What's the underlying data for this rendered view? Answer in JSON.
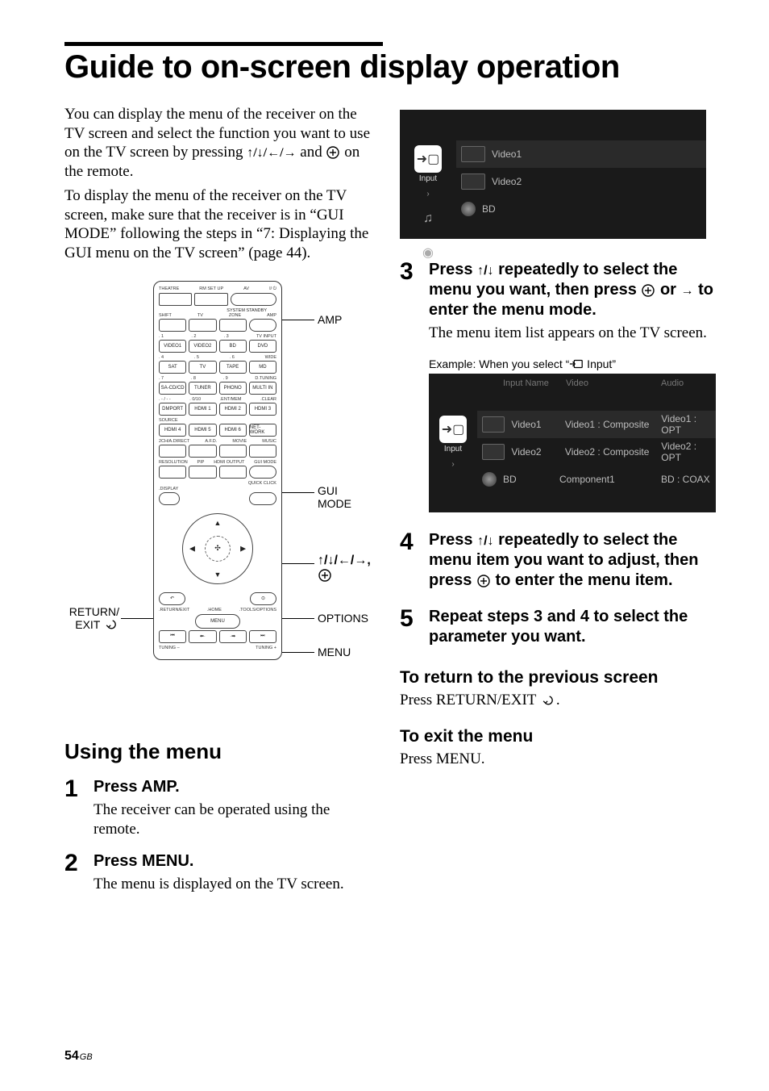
{
  "title": "Guide to on-screen display operation",
  "intro1": "You can display the menu of the receiver on the TV screen and select the function you want to use on the TV screen by pressing ",
  "arrows_inline": "↑/↓/←/→",
  "intro1b": " and ",
  "intro1c": " on the remote.",
  "intro2": "To display the menu of the receiver on the TV screen, make sure that the receiver is in “GUI MODE” following the steps in “7: Displaying the GUI menu on the TV screen” (page 44).",
  "callouts": {
    "amp": "AMP",
    "gui": "GUI\nMODE",
    "dir": "↑/↓/←/→,",
    "options": "OPTIONS",
    "menu": "MENU",
    "return": "RETURN/\nEXIT "
  },
  "remote_labels": {
    "top_row": [
      "THEATRE",
      "RM SET UP",
      "AV",
      " "
    ],
    "top_small": "SYSTEM STANDBY",
    "mode_row": [
      "SHIFT",
      "TV",
      "ZONE",
      "AMP"
    ],
    "grid": [
      [
        ". 1",
        ". 2",
        ". 3",
        "TV INPUT"
      ],
      [
        "VIDEO1",
        "VIDEO2",
        "BD",
        "DVD"
      ],
      [
        ". 4",
        ". 5",
        ". 6",
        "WIDE"
      ],
      [
        "SAT",
        "TV",
        "TAPE",
        "MD"
      ],
      [
        ". 7",
        ". 8",
        ". 9",
        "D.TUNING"
      ],
      [
        "SA-CD/CD",
        "TUNER",
        "PHONO",
        "MULTI IN"
      ],
      [
        ". - / - -",
        ". 0/10",
        ".ENT/MEM",
        ".CLEAR"
      ],
      [
        "DMPORT",
        "HDMI 1",
        "HDMI 2",
        "HDMI 3"
      ],
      [
        "SOURCE",
        "",
        "",
        ""
      ],
      [
        "HDMI 4",
        "HDMI 5",
        "HDMI 6",
        "NET-WORK"
      ],
      [
        "2CH/A.DIRECT",
        "A.F.D.",
        "MOVIE",
        "MUSIC"
      ],
      [
        "RESOLUTION",
        "PIP",
        "HDMI OUTPUT",
        "GUI MODE"
      ],
      [
        "",
        "",
        "",
        "QUICK CLICK"
      ],
      [
        ".DISPLAY",
        "",
        "",
        ""
      ]
    ],
    "below_dpad_l": ".RETURN/EXIT",
    "below_dpad_c": ".HOME",
    "below_dpad_r": ".TOOLS/OPTIONS",
    "menu_btn": "MENU",
    "bottom_small_l": "TUNING –",
    "bottom_small_r": "TUNING +"
  },
  "section": "Using the menu",
  "steps_left": [
    {
      "n": "1",
      "head": "Press AMP.",
      "detail": "The receiver can be operated using the remote."
    },
    {
      "n": "2",
      "head": "Press MENU.",
      "detail": "The menu is displayed on the TV screen."
    }
  ],
  "osd1": {
    "sidebar_active_label": "Input",
    "rows": [
      {
        "label": "Video1",
        "active": true,
        "type": "thumb"
      },
      {
        "label": "Video2",
        "type": "thumb"
      },
      {
        "label": "BD",
        "type": "disc"
      }
    ]
  },
  "steps_right": [
    {
      "n": "3",
      "head_a": "Press ",
      "arrows": "↑/↓",
      "head_b": " repeatedly to select the menu you want, then press ",
      "head_c": " or ",
      "arrow_r": "→",
      "head_d": " to enter the menu mode.",
      "detail": "The menu item list appears on the TV screen."
    },
    {
      "n": "4",
      "head_a": "Press ",
      "arrows": "↑/↓",
      "head_b": " repeatedly to select the menu item you want to adjust, then press ",
      "head_c": " to enter the menu item."
    },
    {
      "n": "5",
      "head": "Repeat steps 3 and 4 to select the parameter you want."
    }
  ],
  "example_label_a": "Example: When you select “",
  "example_label_b": " Input”",
  "osd2": {
    "sidebar_active_label": "Input",
    "headers": [
      "Input Name",
      "Video",
      "Audio"
    ],
    "rows": [
      {
        "c": [
          "Video1",
          "Video1 : Composite",
          "Video1 : OPT"
        ],
        "active": true,
        "type": "thumb"
      },
      {
        "c": [
          "Video2",
          "Video2 : Composite",
          "Video2 : OPT"
        ],
        "type": "thumb"
      },
      {
        "c": [
          "BD",
          "Component1",
          "BD : COAX"
        ],
        "type": "disc"
      }
    ]
  },
  "sub1": "To return to the previous screen",
  "sub1_body": "Press RETURN/EXIT ",
  "sub2": "To exit the menu",
  "sub2_body": "Press MENU.",
  "page_no": "54",
  "page_suffix": "GB"
}
